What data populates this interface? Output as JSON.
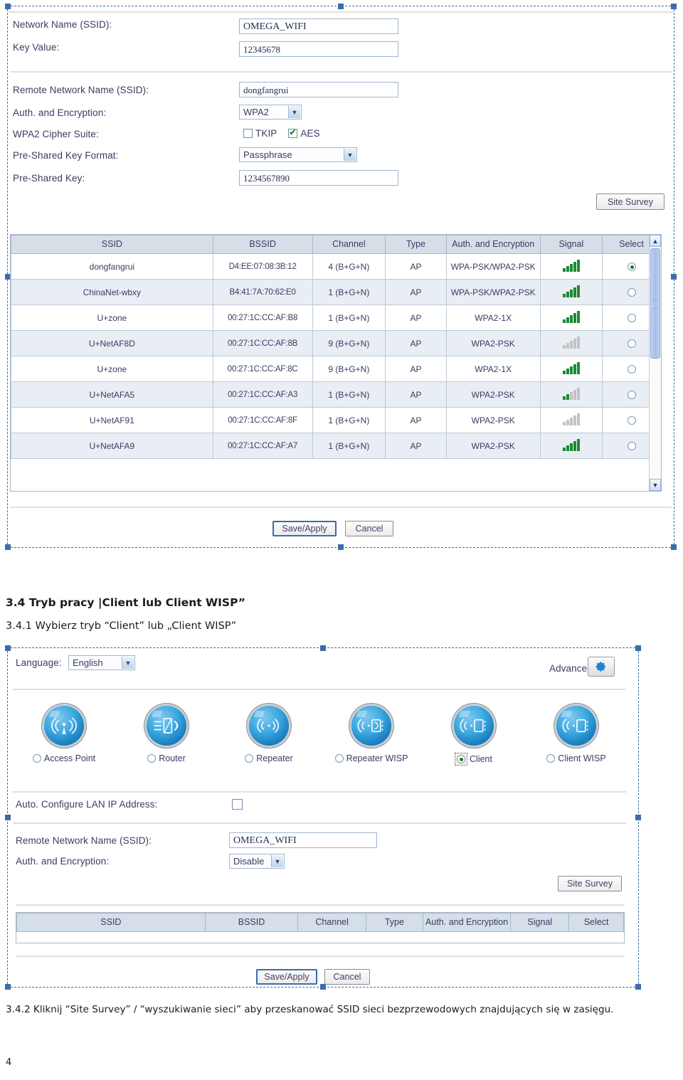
{
  "screen1": {
    "fields": [
      {
        "label": "Network Name (SSID):",
        "value": "OMEGA_WIFI"
      },
      {
        "label": "Key Value:",
        "value": "12345678"
      }
    ],
    "remote": {
      "ssid_label": "Remote Network Name (SSID):",
      "ssid_value": "dongfangrui",
      "auth_label": "Auth. and Encryption:",
      "auth_value": "WPA2",
      "cipher_label": "WPA2 Cipher Suite:",
      "cipher_tkip": "TKIP",
      "cipher_aes": "AES",
      "psk_format_label": "Pre-Shared Key Format:",
      "psk_format_value": "Passphrase",
      "psk_label": "Pre-Shared Key:",
      "psk_value": "1234567890"
    },
    "site_survey_button": "Site Survey",
    "save_button": "Save/Apply",
    "cancel_button": "Cancel"
  },
  "survey_table": {
    "headers": [
      "SSID",
      "BSSID",
      "Channel",
      "Type",
      "Auth. and Encryption",
      "Signal",
      "Select"
    ],
    "rows": [
      {
        "ssid": "dongfangrui",
        "bssid": "D4:EE:07:08:3B:12",
        "channel": "4 (B+G+N)",
        "type": "AP",
        "auth": "WPA-PSK/WPA2-PSK",
        "signal": 5,
        "selected": true
      },
      {
        "ssid": "ChinaNet-wbxy",
        "bssid": "B4:41:7A:70:62:E0",
        "channel": "1 (B+G+N)",
        "type": "AP",
        "auth": "WPA-PSK/WPA2-PSK",
        "signal": 5,
        "selected": false
      },
      {
        "ssid": "U+zone",
        "bssid": "00:27:1C:CC:AF:B8",
        "channel": "1 (B+G+N)",
        "type": "AP",
        "auth": "WPA2-1X",
        "signal": 5,
        "selected": false
      },
      {
        "ssid": "U+NetAF8D",
        "bssid": "00:27:1C:CC:AF:8B",
        "channel": "9 (B+G+N)",
        "type": "AP",
        "auth": "WPA2-PSK",
        "signal": 0,
        "selected": false
      },
      {
        "ssid": "U+zone",
        "bssid": "00:27:1C:CC:AF:8C",
        "channel": "9 (B+G+N)",
        "type": "AP",
        "auth": "WPA2-1X",
        "signal": 5,
        "selected": false
      },
      {
        "ssid": "U+NetAFA5",
        "bssid": "00:27:1C:CC:AF:A3",
        "channel": "1 (B+G+N)",
        "type": "AP",
        "auth": "WPA2-PSK",
        "signal": 2,
        "selected": false
      },
      {
        "ssid": "U+NetAF91",
        "bssid": "00:27:1C:CC:AF:8F",
        "channel": "1 (B+G+N)",
        "type": "AP",
        "auth": "WPA2-PSK",
        "signal": 0,
        "selected": false
      },
      {
        "ssid": "U+NetAFA9",
        "bssid": "00:27:1C:CC:AF:A7",
        "channel": "1 (B+G+N)",
        "type": "AP",
        "auth": "WPA2-PSK",
        "signal": 5,
        "selected": false
      }
    ]
  },
  "doc": {
    "heading": "3.4 Tryb pracy |Client lub Client WISP”",
    "sub": "3.4.1 Wybierz tryb “Client” lub „Client WISP”",
    "para": "3.4.2 Kliknij “Site Survey”  / “wyszukiwanie sieci” aby przeskanować SSID sieci bezprzewodowych znajdujących się w zasięgu.",
    "page_number": "4"
  },
  "screen2": {
    "language_label": "Language:",
    "language_value": "English",
    "advanced_label": "Advanced:",
    "modes": [
      {
        "label": "Access Point",
        "selected": false,
        "icon": "access-point-icon"
      },
      {
        "label": "Router",
        "selected": false,
        "icon": "router-icon"
      },
      {
        "label": "Repeater",
        "selected": false,
        "icon": "repeater-icon"
      },
      {
        "label": "Repeater WISP",
        "selected": false,
        "icon": "repeater-wisp-icon"
      },
      {
        "label": "Client",
        "selected": true,
        "icon": "client-icon"
      },
      {
        "label": "Client WISP",
        "selected": false,
        "icon": "client-wisp-icon"
      }
    ],
    "auto_lan_label": "Auto. Configure LAN IP Address:",
    "ssid_label": "Remote Network Name (SSID):",
    "ssid_value": "OMEGA_WIFI",
    "auth_label": "Auth. and Encryption:",
    "auth_value": "Disable",
    "site_survey_button": "Site Survey",
    "save_button": "Save/Apply",
    "cancel_button": "Cancel",
    "table_headers": [
      "SSID",
      "BSSID",
      "Channel",
      "Type",
      "Auth. and Encryption",
      "Signal",
      "Select"
    ]
  },
  "colors": {
    "accent": "#3a6ea5",
    "signal_green": "#1d8a33",
    "header_bg": "#d6dfe8",
    "row_alt": "#e8eef4"
  }
}
